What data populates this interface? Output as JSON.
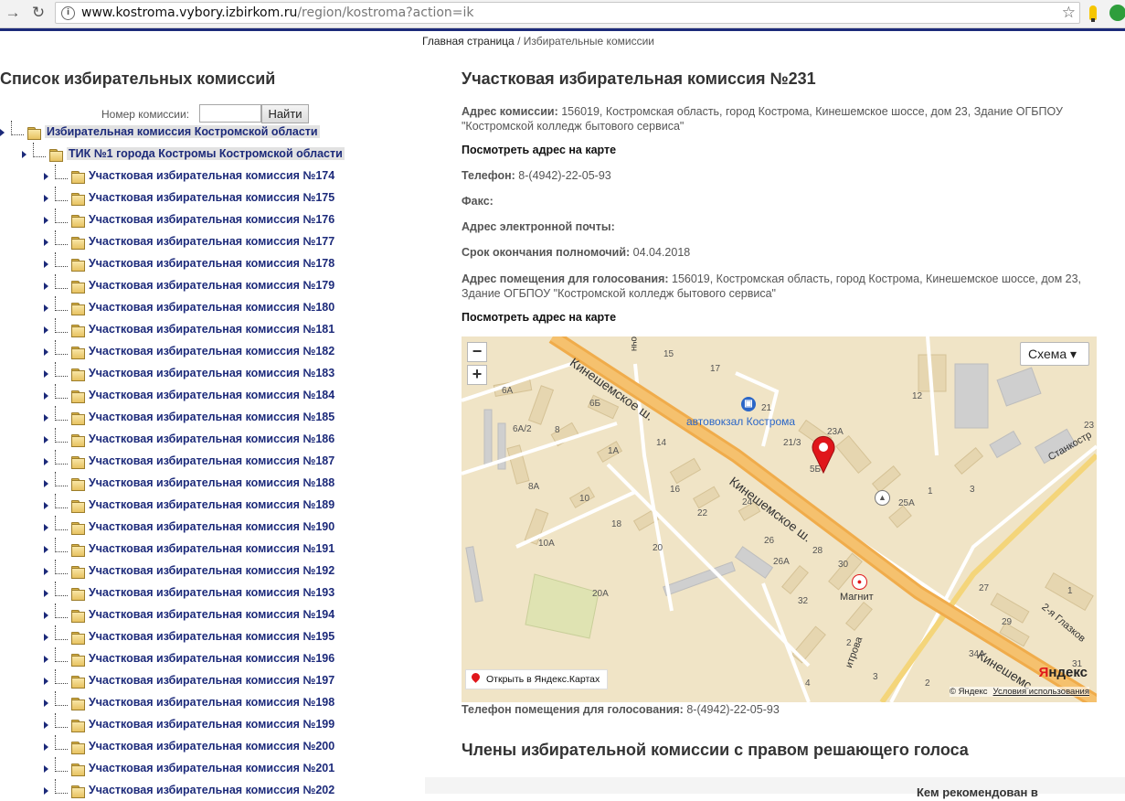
{
  "browser": {
    "url_host": "www.kostroma.vybory.izbirkom.ru",
    "url_path": "/region/kostroma?action=ik",
    "back_icon": "arrow-right-icon",
    "reload_icon": "reload-icon",
    "info_glyph": "i",
    "star_glyph": "☆"
  },
  "breadcrumb": {
    "home": "Главная страница",
    "separator": " / ",
    "current": "Избирательные комиссии"
  },
  "tree": {
    "title": "Список избирательных комиссий",
    "search_label": "Номер комиссии:",
    "search_value": "",
    "search_button": "Найти",
    "root": "Избирательная комиссия Костромской области",
    "tik": "ТИК №1 города Костромы Костромской области",
    "items": [
      "Участковая избирательная комиссия №174",
      "Участковая избирательная комиссия №175",
      "Участковая избирательная комиссия №176",
      "Участковая избирательная комиссия №177",
      "Участковая избирательная комиссия №178",
      "Участковая избирательная комиссия №179",
      "Участковая избирательная комиссия №180",
      "Участковая избирательная комиссия №181",
      "Участковая избирательная комиссия №182",
      "Участковая избирательная комиссия №183",
      "Участковая избирательная комиссия №184",
      "Участковая избирательная комиссия №185",
      "Участковая избирательная комиссия №186",
      "Участковая избирательная комиссия №187",
      "Участковая избирательная комиссия №188",
      "Участковая избирательная комиссия №189",
      "Участковая избирательная комиссия №190",
      "Участковая избирательная комиссия №191",
      "Участковая избирательная комиссия №192",
      "Участковая избирательная комиссия №193",
      "Участковая избирательная комиссия №194",
      "Участковая избирательная комиссия №195",
      "Участковая избирательная комиссия №196",
      "Участковая избирательная комиссия №197",
      "Участковая избирательная комиссия №198",
      "Участковая избирательная комиссия №199",
      "Участковая избирательная комиссия №200",
      "Участковая избирательная комиссия №201",
      "Участковая избирательная комиссия №202"
    ]
  },
  "detail": {
    "title": "Участковая избирательная комиссия №231",
    "address_label": "Адрес комиссии:",
    "address_value": " 156019, Костромская область, город Кострома, Кинешемское шоссе, дом 23, Здание ОГБПОУ \"Костромской колледж бытового сервиса\"",
    "map_link_1": "Посмотреть адрес на карте",
    "phone_label": "Телефон:",
    "phone_value": " 8-(4942)-22-05-93",
    "fax_label": "Факс:",
    "fax_value": "",
    "email_label": "Адрес электронной почты:",
    "email_value": "",
    "term_label": "Срок окончания полномочий:",
    "term_value": " 04.04.2018",
    "voting_address_label": "Адрес помещения для голосования:",
    "voting_address_value": " 156019, Костромская область, город Кострома, Кинешемское шоссе, дом 23, Здание ОГБПОУ \"Костромской колледж бытового сервиса\"",
    "map_link_2": "Посмотреть адрес на карте",
    "voting_phone_label": "Телефон помещения для голосования:",
    "voting_phone_value": " 8-(4942)-22-05-93",
    "members_title": "Члены избирательной комиссии с правом решающего голоса",
    "table_header_partial": "Кем рекомендован в"
  },
  "map": {
    "zoom_out": "−",
    "zoom_in": "+",
    "layer_select": "Схема ▾",
    "open_button": "Открыть в Яндекс.Картах",
    "logo_prefix": "Я",
    "logo_rest": "ндекс",
    "copyright": "© Яндекс",
    "terms": "Условия использования",
    "streets": {
      "main_1": "Кинешемское ш.",
      "main_2": "Кинешемское ш.",
      "main_3": "Кинешемс",
      "stankostr": "Станкостр",
      "glazkov": "2-я Глазков",
      "dmitrova": "итрова",
      "ochn": "очн"
    },
    "poi": {
      "bus_station": "автовокзал Кострома",
      "magnit": "Магнит"
    },
    "house_numbers": [
      "15",
      "17",
      "6А",
      "6Б",
      "21",
      "6А/2",
      "8",
      "14",
      "23А",
      "21/3",
      "12",
      "23",
      "1А",
      "5Б",
      "3",
      "1",
      "25А",
      "16",
      "24",
      "8А",
      "10",
      "22",
      "18",
      "10А",
      "20",
      "26",
      "26А",
      "28",
      "30",
      "20А",
      "32",
      "27",
      "29",
      "1",
      "2",
      "34А",
      "4",
      "3",
      "2",
      "31"
    ]
  }
}
